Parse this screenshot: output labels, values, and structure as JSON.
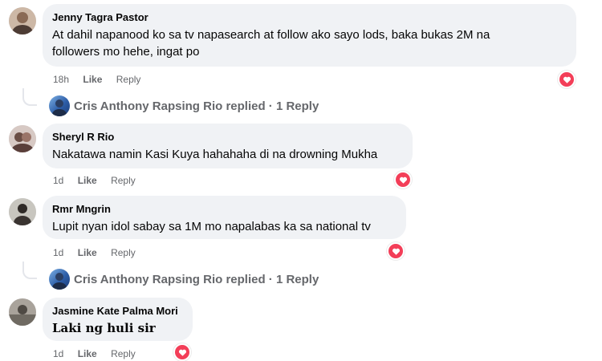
{
  "comments": [
    {
      "author": "Jenny Tagra Pastor",
      "text_line1": "At dahil napanood ko sa tv napasearch at follow ako sayo lods, baka bukas 2M na",
      "text_line2": "followers mo hehe, ingat po",
      "time": "18h",
      "like": "Like",
      "reply": "Reply",
      "reaction": "heart-reaction"
    },
    {
      "author": "Sheryl R Rio",
      "text": "Nakatawa namin Kasi Kuya hahahaha di na drowning Mukha",
      "time": "1d",
      "like": "Like",
      "reply": "Reply",
      "reaction": "heart-reaction"
    },
    {
      "author": "Rmr Mngrin",
      "text": "Lupit nyan idol sabay sa 1M mo napalabas ka sa national tv",
      "time": "1d",
      "like": "Like",
      "reply": "Reply",
      "reaction": "heart-reaction"
    },
    {
      "author": "Jasmine Kate Palma Mori",
      "text": "𝐋𝐚𝐤𝐢 𝐧𝐠 𝐡𝐮𝐥𝐢 𝐬𝐢𝐫",
      "time": "1d",
      "like": "Like",
      "reply": "Reply",
      "reaction": "heart-reaction"
    }
  ],
  "replies_summary": [
    {
      "text": "Cris Anthony Rapsing Rio replied · 1 Reply"
    },
    {
      "text": "Cris Anthony Rapsing Rio replied · 1 Reply"
    }
  ],
  "colors": {
    "bubble": "#f0f2f5",
    "meta_text": "#65676b",
    "heart": "#f33e58",
    "thread_line": "#e4e6eb"
  }
}
